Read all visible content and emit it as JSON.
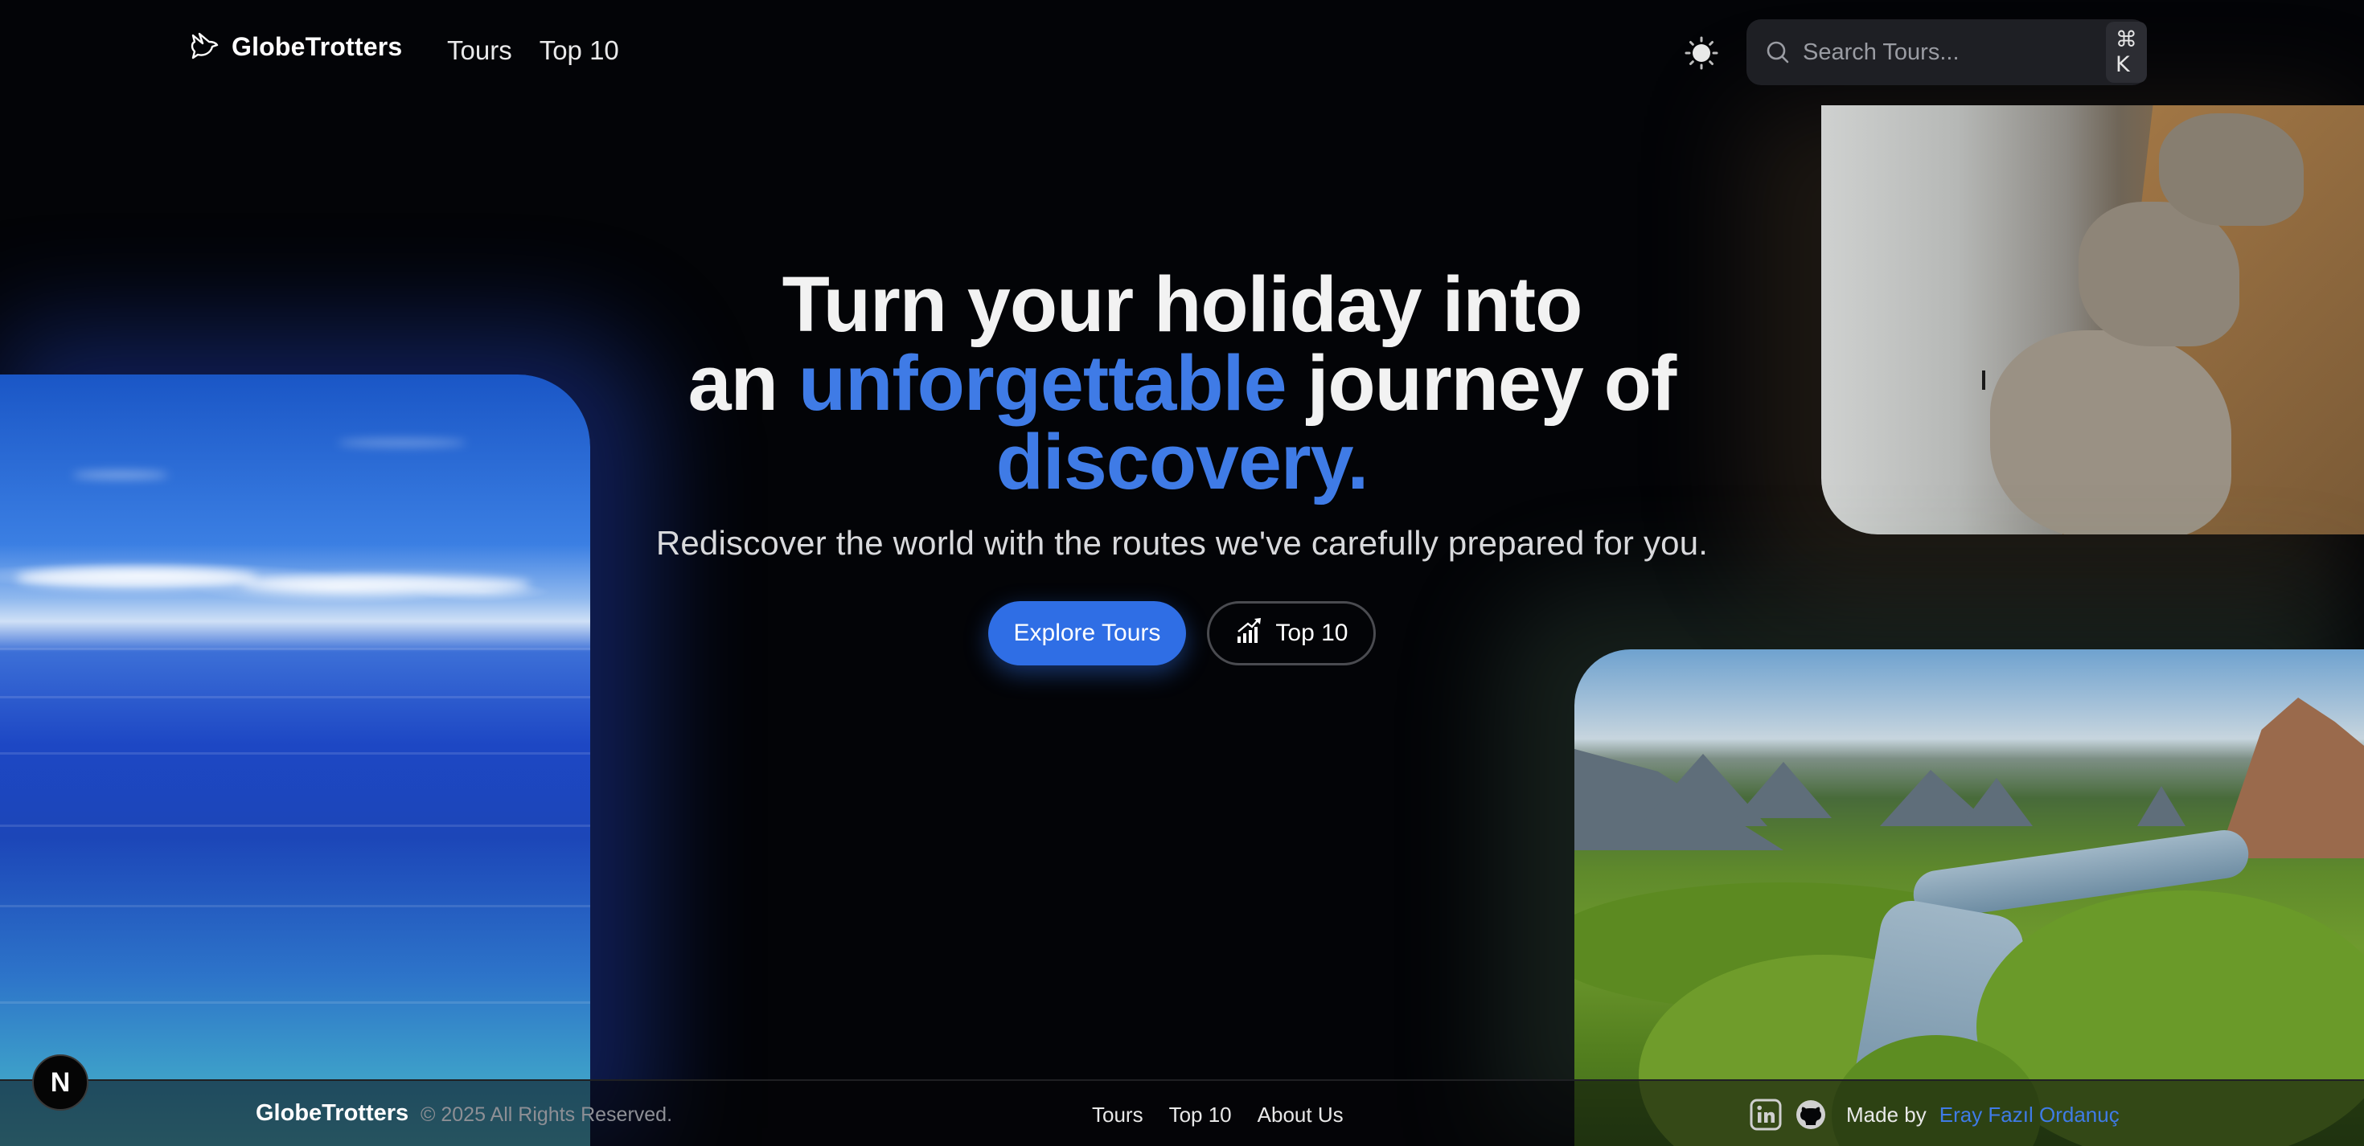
{
  "header": {
    "brand": "GlobeTrotters",
    "nav": [
      "Tours",
      "Top 10"
    ],
    "search": {
      "placeholder": "Search Tours...",
      "shortcut": "⌘ K"
    }
  },
  "hero": {
    "title_line1": "Turn your holiday into",
    "title_line2_prefix": "an",
    "title_line2_accent": "unforgettable",
    "title_line2_suffix": "journey of",
    "title_line3_accent": "discovery.",
    "subtitle": "Rediscover the world with the routes we've carefully prepared for you.",
    "primary_cta": "Explore Tours",
    "secondary_cta": "Top 10"
  },
  "footer": {
    "brand": "GlobeTrotters",
    "copyright": "© 2025 All Rights Reserved.",
    "nav": [
      "Tours",
      "Top 10",
      "About Us"
    ],
    "made_by": "Made by",
    "author": "Eray Fazıl Ordanuç"
  },
  "badge": "N",
  "colors": {
    "background": "#030407",
    "accent": "#3f7be6",
    "primary_button": "#2f6ee5",
    "search_bg": "#1e1f24"
  },
  "icons": [
    "bird-logo-icon",
    "sun-icon",
    "search-icon",
    "chart-arrow-icon",
    "linkedin-icon",
    "github-icon"
  ]
}
